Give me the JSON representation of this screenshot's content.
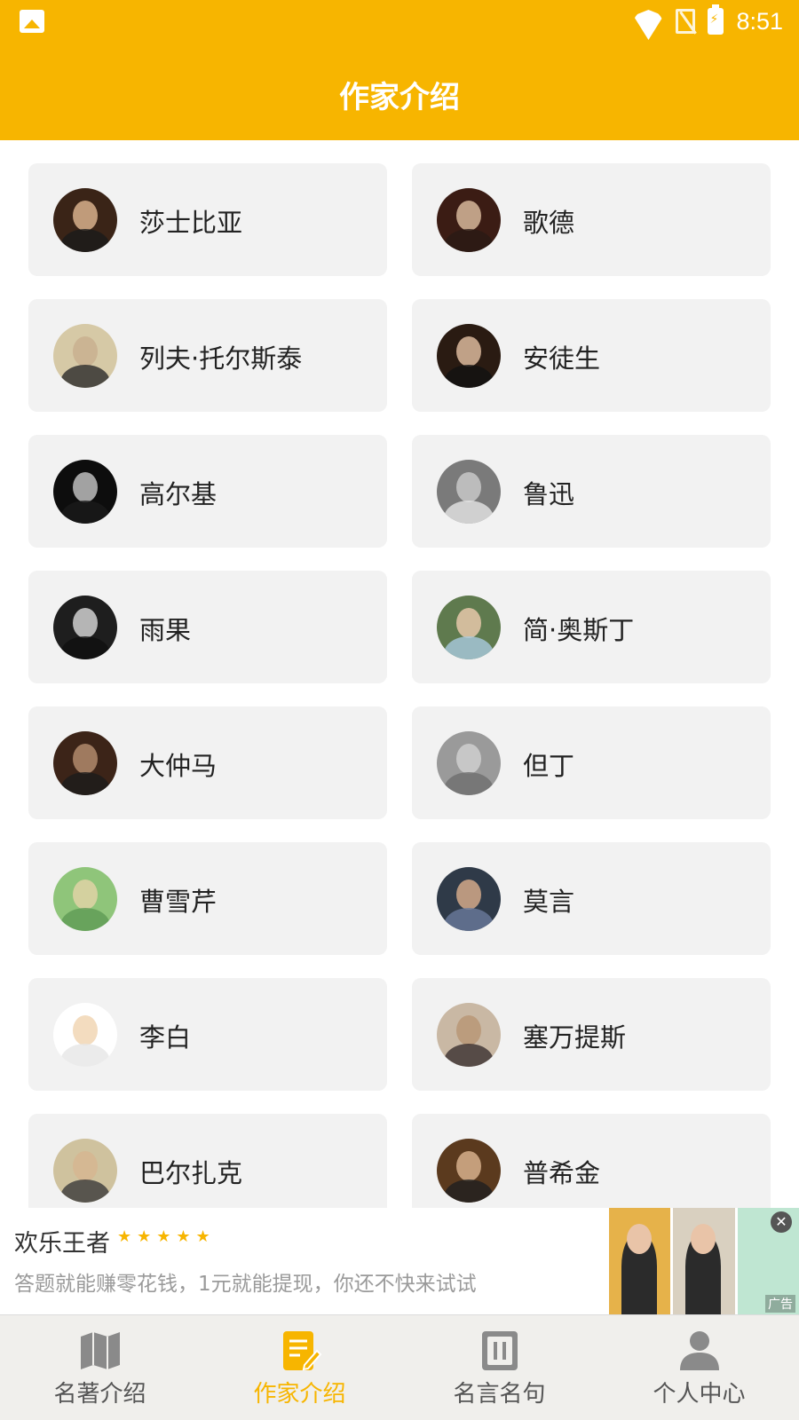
{
  "status_bar": {
    "time": "8:51"
  },
  "header": {
    "title": "作家介绍"
  },
  "authors": [
    {
      "name": "莎士比亚",
      "avatar_colors": [
        "#3a2417",
        "#d8b08c",
        "#1a1a1a"
      ]
    },
    {
      "name": "歌德",
      "avatar_colors": [
        "#3b1c14",
        "#d7b79a",
        "#2a1a14"
      ]
    },
    {
      "name": "列夫·托尔斯泰",
      "avatar_colors": [
        "#d6c9a6",
        "#c9b08f",
        "#2b2b2b"
      ]
    },
    {
      "name": "安徒生",
      "avatar_colors": [
        "#2a1b12",
        "#dbb99c",
        "#111111"
      ]
    },
    {
      "name": "高尔基",
      "avatar_colors": [
        "#0d0d0d",
        "#bdbdbd",
        "#1a1a1a"
      ]
    },
    {
      "name": "鲁迅",
      "avatar_colors": [
        "#7a7a7a",
        "#c8c8c8",
        "#e6e6e6"
      ]
    },
    {
      "name": "雨果",
      "avatar_colors": [
        "#1e1e1e",
        "#d0d0d0",
        "#0f0f0f"
      ]
    },
    {
      "name": "简·奥斯丁",
      "avatar_colors": [
        "#5f7a4e",
        "#e6c8aa",
        "#a9cbe0"
      ]
    },
    {
      "name": "大仲马",
      "avatar_colors": [
        "#3c2418",
        "#b08a6c",
        "#1b1b1b"
      ]
    },
    {
      "name": "但丁",
      "avatar_colors": [
        "#9a9a9a",
        "#cfcfcf",
        "#6e6e6e"
      ]
    },
    {
      "name": "曹雪芹",
      "avatar_colors": [
        "#8fc57a",
        "#e0d2a6",
        "#5e9a55"
      ]
    },
    {
      "name": "莫言",
      "avatar_colors": [
        "#2f3a48",
        "#d2a98a",
        "#6a7a9c"
      ]
    },
    {
      "name": "李白",
      "avatar_colors": [
        "#ffffff",
        "#f1d6b4",
        "#e6e6e6"
      ]
    },
    {
      "name": "塞万提斯",
      "avatar_colors": [
        "#c9b8a4",
        "#b99677",
        "#3a3030"
      ]
    },
    {
      "name": "巴尔扎克",
      "avatar_colors": [
        "#cfc29e",
        "#d6b690",
        "#3a3a3a"
      ]
    },
    {
      "name": "普希金",
      "avatar_colors": [
        "#5b3a1e",
        "#d7b08c",
        "#1f1f1f"
      ]
    }
  ],
  "ad": {
    "title": "欢乐王者",
    "stars": "★★★★★",
    "description": "答题就能赚零花钱，1元就能提现，你还不快来试试",
    "tag": "广告",
    "close": "✕",
    "thumb_colors": [
      "#e6b24a",
      "#d9d0c0",
      "#bfe6d2"
    ]
  },
  "bottom_nav": [
    {
      "label": "名著介绍",
      "active": false
    },
    {
      "label": "作家介绍",
      "active": true
    },
    {
      "label": "名言名句",
      "active": false
    },
    {
      "label": "个人中心",
      "active": false
    }
  ],
  "colors": {
    "accent": "#f7b500",
    "card_bg": "#f2f2f2",
    "nav_inactive": "#888888"
  }
}
